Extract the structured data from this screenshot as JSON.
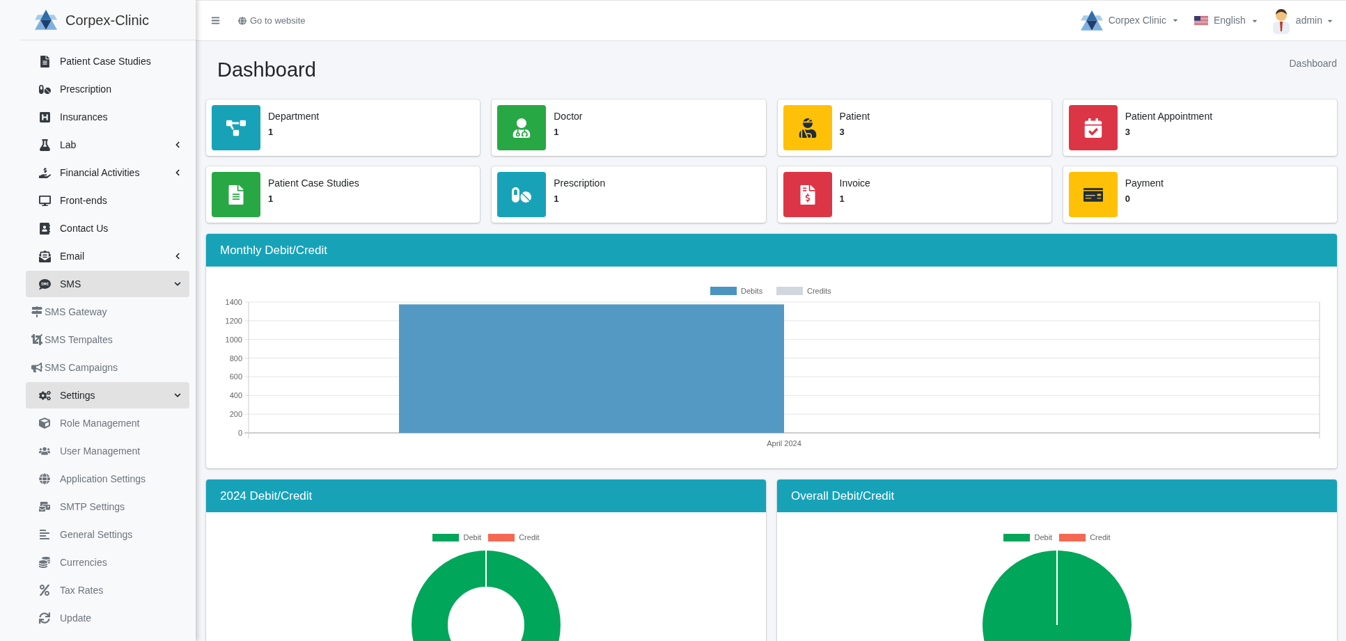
{
  "sidebar": {
    "brand": "Corpex-Clinic",
    "items": [
      {
        "label": "Patient Case Studies"
      },
      {
        "label": "Prescription"
      },
      {
        "label": "Insurances"
      },
      {
        "label": "Lab",
        "expanded": false
      },
      {
        "label": "Financial Activities",
        "expanded": false
      },
      {
        "label": "Front-ends"
      },
      {
        "label": "Contact Us"
      },
      {
        "label": "Email",
        "expanded": false
      },
      {
        "label": "SMS",
        "expanded": true,
        "children": [
          {
            "label": "SMS Gateway"
          },
          {
            "label": "SMS Tempaltes"
          },
          {
            "label": "SMS Campaigns"
          }
        ]
      },
      {
        "label": "Settings",
        "expanded": true,
        "children": [
          {
            "label": "Role Management"
          },
          {
            "label": "User Management"
          },
          {
            "label": "Application Settings"
          },
          {
            "label": "SMTP Settings"
          },
          {
            "label": "General Settings"
          },
          {
            "label": "Currencies"
          },
          {
            "label": "Tax Rates"
          },
          {
            "label": "Update"
          }
        ]
      }
    ]
  },
  "topbar": {
    "website_link": "Go to website",
    "clinic": "Corpex Clinic",
    "language": "English",
    "user": "admin"
  },
  "page": {
    "title": "Dashboard",
    "breadcrumb": "Dashboard"
  },
  "stats": [
    {
      "label": "Department",
      "value": "1",
      "color": "#17a2b8"
    },
    {
      "label": "Doctor",
      "value": "1",
      "color": "#28a745"
    },
    {
      "label": "Patient",
      "value": "3",
      "color": "#ffc107"
    },
    {
      "label": "Patient Appointment",
      "value": "3",
      "color": "#dc3545"
    },
    {
      "label": "Patient Case Studies",
      "value": "1",
      "color": "#28a745"
    },
    {
      "label": "Prescription",
      "value": "1",
      "color": "#17a2b8"
    },
    {
      "label": "Invoice",
      "value": "1",
      "color": "#dc3545"
    },
    {
      "label": "Payment",
      "value": "0",
      "color": "#ffc107"
    }
  ],
  "monthly": {
    "title": "Monthly Debit/Credit",
    "chart_data": {
      "type": "bar",
      "categories": [
        "April 2024"
      ],
      "series": [
        {
          "name": "Debits",
          "color": "#4b94c0",
          "values": [
            1375
          ]
        },
        {
          "name": "Credits",
          "color": "#d2d6de",
          "values": [
            0
          ]
        }
      ],
      "grid": true,
      "ylim": [
        0,
        1400
      ],
      "yticks": [
        0,
        200,
        400,
        600,
        800,
        1000,
        1200,
        1400
      ]
    }
  },
  "yearly": {
    "title": "2024 Debit/Credit",
    "legend": [
      {
        "label": "Debit",
        "color": "#00a65a"
      },
      {
        "label": "Credit",
        "color": "#f56954"
      }
    ]
  },
  "overall": {
    "title": "Overall Debit/Credit",
    "legend": [
      {
        "label": "Debit",
        "color": "#00a65a"
      },
      {
        "label": "Credit",
        "color": "#f56954"
      }
    ]
  }
}
